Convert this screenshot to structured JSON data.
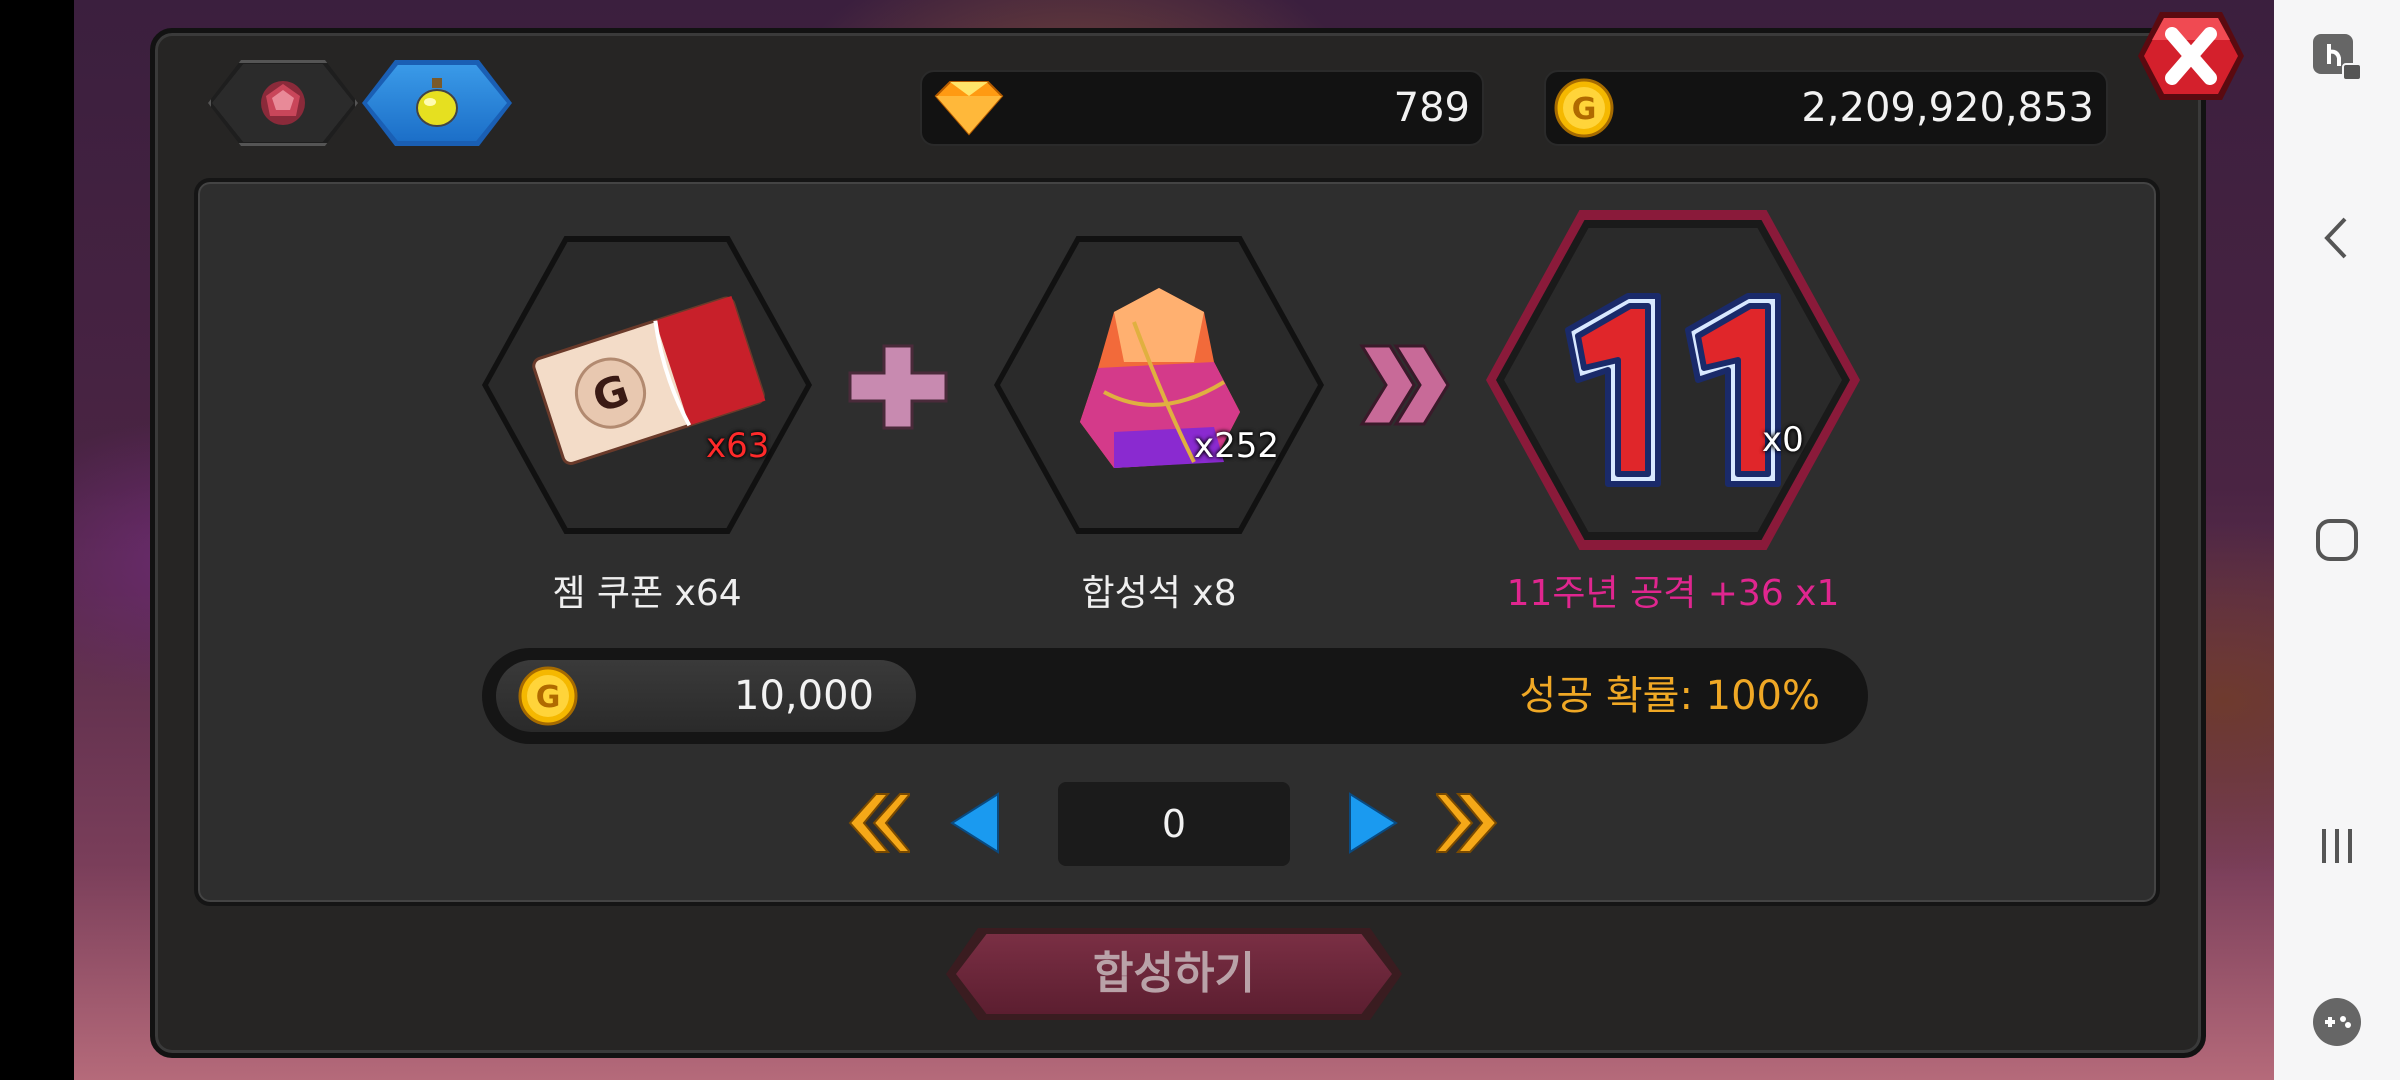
{
  "currencies": {
    "gems": "789",
    "gold": "2,209,920,853"
  },
  "recipe": {
    "ingredient1": {
      "name": "젬 쿠폰 x64",
      "count": "x63"
    },
    "ingredient2": {
      "name": "합성석 x8",
      "count": "x252"
    },
    "result": {
      "name": "11주년 공격 +36 x1",
      "count": "x0",
      "badge_text": "11"
    }
  },
  "cost": {
    "gold": "10,000",
    "success_rate": "성공 확률: 100%"
  },
  "pager": {
    "value": "0"
  },
  "synthesize_label": "합성하기",
  "colors": {
    "result_label": "#e0268f",
    "success_rate": "#f0a825",
    "ingredient1_count": "#ff2a2a",
    "synth_button": "#6b2438"
  },
  "icons": {
    "tab1": "gem-tab-icon",
    "tab2": "potion-tab-icon",
    "gem": "diamond-icon",
    "gold": "gold-coin-icon"
  }
}
